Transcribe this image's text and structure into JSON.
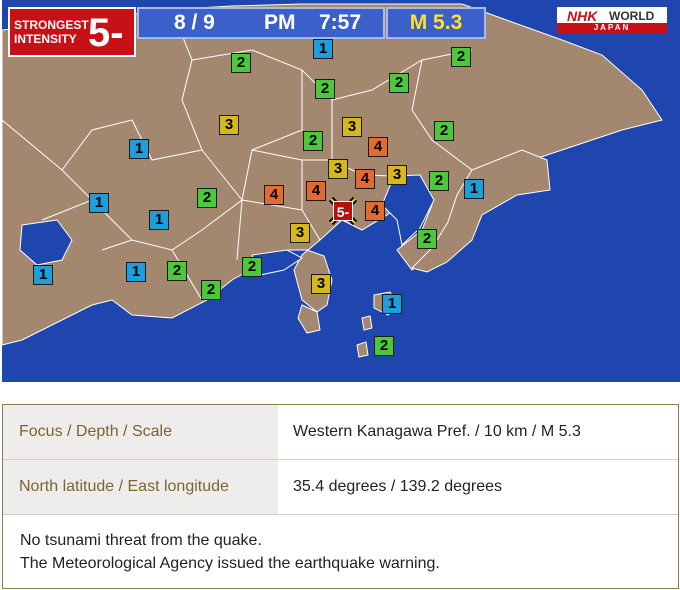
{
  "header": {
    "strongest_label": "STRONGEST\nINTENSITY",
    "strongest_value": "5-",
    "date": "8 / 9",
    "ampm": "PM",
    "time": "7:57",
    "magnitude": "M 5.3"
  },
  "logo": {
    "nhk": "NHK",
    "world": "WORLD",
    "japan": "JAPAN"
  },
  "colors": {
    "sea": "#1f45ae",
    "land": "#a3876e",
    "intensity_1": "#1e9fdb",
    "intensity_2": "#4cc93b",
    "intensity_3": "#d6b81b",
    "intensity_4": "#e46a2f",
    "epicenter": "#b30f14"
  },
  "map": {
    "epicenter_label": "5-",
    "intensity_badges": [
      "1",
      "2",
      "2",
      "2",
      "2",
      "3",
      "3",
      "2",
      "2",
      "4",
      "1",
      "3",
      "4",
      "3",
      "2",
      "1",
      "1",
      "2",
      "4",
      "4",
      "4",
      "1",
      "3",
      "2",
      "1",
      "1",
      "2",
      "2",
      "2",
      "3",
      "1",
      "2"
    ]
  },
  "info": {
    "rows": [
      {
        "label": "Focus / Depth / Scale",
        "value": "Western Kanagawa Pref. / 10 km / M 5.3"
      },
      {
        "label": "North latitude / East longitude",
        "value": "35.4 degrees / 139.2 degrees"
      }
    ],
    "notes": [
      "No tsunami threat from the quake.",
      "The Meteorological Agency issued the earthquake warning."
    ]
  }
}
